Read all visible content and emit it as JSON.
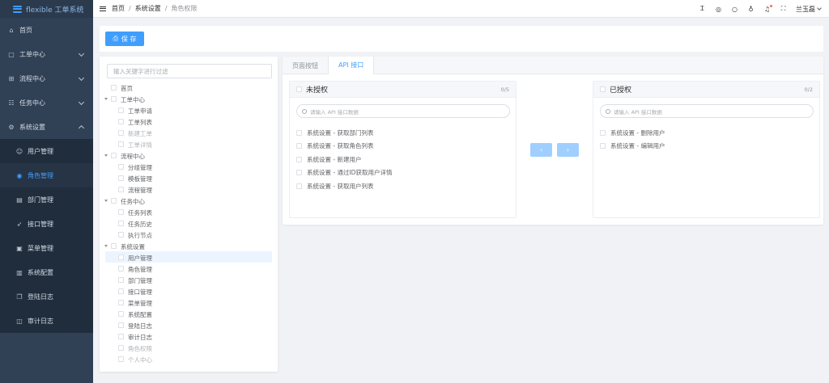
{
  "app": {
    "title": "flexible 工单系统"
  },
  "sidebar": {
    "items": [
      {
        "label": "首页",
        "icon": "home-icon",
        "glyph": "⌂",
        "expandable": false
      },
      {
        "label": "工单中心",
        "icon": "ticket-icon",
        "glyph": "▢",
        "expandable": true
      },
      {
        "label": "流程中心",
        "icon": "flow-icon",
        "glyph": "⊞",
        "expandable": true
      },
      {
        "label": "任务中心",
        "icon": "task-icon",
        "glyph": "☷",
        "expandable": true
      },
      {
        "label": "系统设置",
        "icon": "gear-icon",
        "glyph": "⚙",
        "expandable": true,
        "expanded": true
      }
    ],
    "sub_items": [
      {
        "label": "用户管理",
        "icon": "user-icon",
        "glyph": "☺"
      },
      {
        "label": "角色管理",
        "icon": "role-icon",
        "glyph": "◉",
        "active": true
      },
      {
        "label": "部门管理",
        "icon": "department-icon",
        "glyph": "▤"
      },
      {
        "label": "接口管理",
        "icon": "api-icon",
        "glyph": "➶"
      },
      {
        "label": "菜单管理",
        "icon": "menu-icon",
        "glyph": "▣"
      },
      {
        "label": "系统配置",
        "icon": "config-icon",
        "glyph": "▥"
      },
      {
        "label": "登陆日志",
        "icon": "login-log-icon",
        "glyph": "❐"
      },
      {
        "label": "审计日志",
        "icon": "audit-log-icon",
        "glyph": "◫"
      }
    ]
  },
  "header": {
    "breadcrumb": [
      "首页",
      "系统设置",
      "角色权限"
    ],
    "separator": "/",
    "icons": [
      {
        "name": "translate-icon",
        "glyph": "Ꮖ"
      },
      {
        "name": "github-icon",
        "glyph": "◎"
      },
      {
        "name": "search-icon",
        "glyph": "○"
      },
      {
        "name": "theme-shirt-icon",
        "glyph": "♁"
      },
      {
        "name": "bell-icon",
        "glyph": "♫",
        "badge": true
      },
      {
        "name": "fullscreen-icon",
        "glyph": "⛶"
      }
    ],
    "user": "兰玉磊"
  },
  "toolbar": {
    "save_label": "保 存",
    "save_icon": "⎙"
  },
  "tree": {
    "filter_placeholder": "输入关键字进行过滤",
    "nodes": [
      {
        "label": "首页",
        "level": 0,
        "toggle": false
      },
      {
        "label": "工单中心",
        "level": 0,
        "toggle": true
      },
      {
        "label": "工单申请",
        "level": 1
      },
      {
        "label": "工单列表",
        "level": 1
      },
      {
        "label": "新建工单",
        "level": 1,
        "dim": true
      },
      {
        "label": "工单详情",
        "level": 1,
        "dim": true
      },
      {
        "label": "流程中心",
        "level": 0,
        "toggle": true
      },
      {
        "label": "分组管理",
        "level": 1
      },
      {
        "label": "模板管理",
        "level": 1
      },
      {
        "label": "流程管理",
        "level": 1
      },
      {
        "label": "任务中心",
        "level": 0,
        "toggle": true
      },
      {
        "label": "任务列表",
        "level": 1
      },
      {
        "label": "任务历史",
        "level": 1
      },
      {
        "label": "执行节点",
        "level": 1
      },
      {
        "label": "系统设置",
        "level": 0,
        "toggle": true
      },
      {
        "label": "用户管理",
        "level": 1,
        "highlight": true
      },
      {
        "label": "角色管理",
        "level": 1
      },
      {
        "label": "部门管理",
        "level": 1
      },
      {
        "label": "接口管理",
        "level": 1
      },
      {
        "label": "菜单管理",
        "level": 1
      },
      {
        "label": "系统配置",
        "level": 1
      },
      {
        "label": "登陆日志",
        "level": 1
      },
      {
        "label": "审计日志",
        "level": 1
      },
      {
        "label": "角色权限",
        "level": 1,
        "dim": true
      },
      {
        "label": "个人中心",
        "level": 1,
        "dim": true
      }
    ]
  },
  "tabs": [
    {
      "label": "页面按钮",
      "active": false
    },
    {
      "label": "API 接口",
      "active": true
    }
  ],
  "transfer": {
    "left": {
      "title": "未授权",
      "count": "0/5",
      "placeholder": "请输入 API 接口数据",
      "items": [
        "系统设置 - 获取部门列表",
        "系统设置 - 获取角色列表",
        "系统设置 - 新建用户",
        "系统设置 - 通过ID获取用户详情",
        "系统设置 - 获取用户列表"
      ]
    },
    "right": {
      "title": "已授权",
      "count": "0/2",
      "placeholder": "请输入 API 接口数据",
      "items": [
        "系统设置 - 删除用户",
        "系统设置 - 编辑用户"
      ]
    },
    "to_left_glyph": "‹",
    "to_right_glyph": "›"
  },
  "colors": {
    "sidebar": "#304156",
    "accent": "#409eff",
    "disabled_btn": "#a0cfff"
  }
}
